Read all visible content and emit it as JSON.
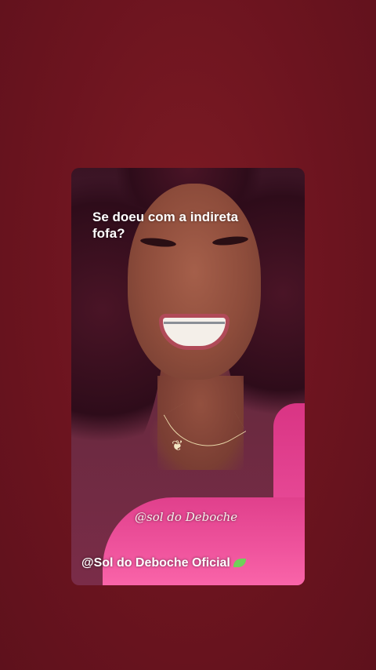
{
  "story": {
    "caption": "Se doeu com a indireta\nfofa?",
    "watermark": "@sol do Deboche",
    "credit": "@Sol do Deboche Oficial",
    "credit_emoji_icon": "four-leaf-clover-icon"
  },
  "colors": {
    "background": "#6c141f",
    "top_garment": "#f0559e"
  }
}
